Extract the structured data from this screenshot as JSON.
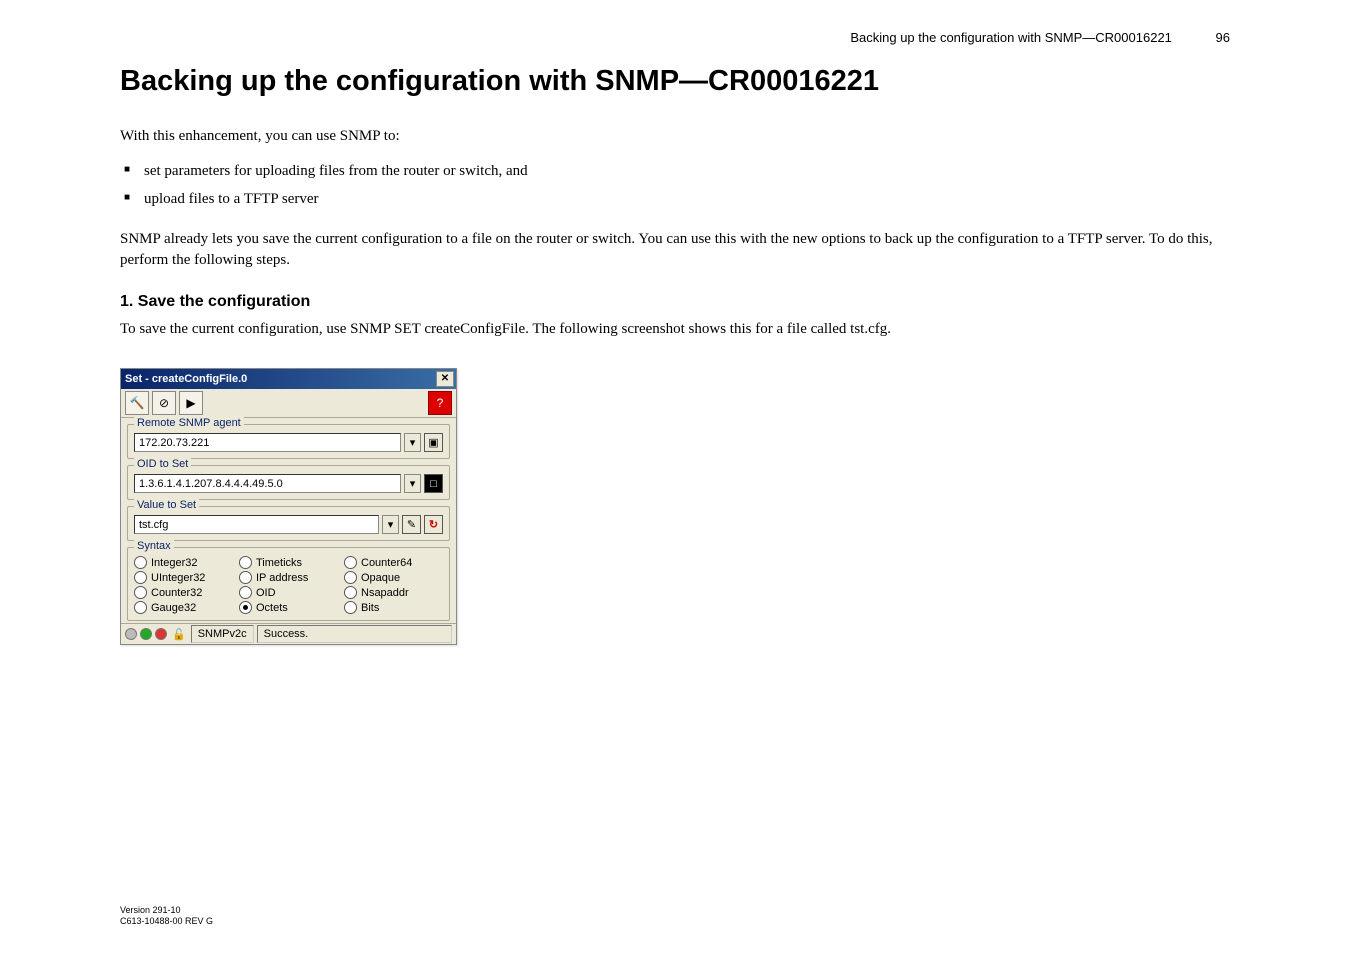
{
  "header": {
    "running_title": "Backing up the configuration with SNMP—CR00016221",
    "page_number": "96"
  },
  "title": "Backing up the configuration with SNMP—CR00016221",
  "intro": "With this enhancement, you can use SNMP to:",
  "bullets": [
    "set parameters for uploading files from the router or switch, and",
    "upload files to a TFTP server"
  ],
  "para2": "SNMP already lets you save the current configuration to a file on the router or switch. You can use this with the new options to back up the configuration to a TFTP server. To do this, perform the following steps.",
  "step1_heading": "1.  Save the configuration",
  "step1_text": "To save the current configuration, use SNMP SET createConfigFile. The following screenshot shows this for a file called tst.cfg.",
  "dialog": {
    "title": "Set - createConfigFile.0",
    "remote_agent_label": "Remote SNMP agent",
    "remote_agent_value": "172.20.73.221",
    "oid_label": "OID to Set",
    "oid_value": "1.3.6.1.4.1.207.8.4.4.4.49.5.0",
    "value_label": "Value to Set",
    "value_value": "tst.cfg",
    "syntax_label": "Syntax",
    "syntax_options": [
      {
        "label": "Integer32",
        "selected": false
      },
      {
        "label": "Timeticks",
        "selected": false
      },
      {
        "label": "Counter64",
        "selected": false
      },
      {
        "label": "UInteger32",
        "selected": false
      },
      {
        "label": "IP address",
        "selected": false
      },
      {
        "label": "Opaque",
        "selected": false
      },
      {
        "label": "Counter32",
        "selected": false
      },
      {
        "label": "OID",
        "selected": false
      },
      {
        "label": "Nsapaddr",
        "selected": false
      },
      {
        "label": "Gauge32",
        "selected": false
      },
      {
        "label": "Octets",
        "selected": true
      },
      {
        "label": "Bits",
        "selected": false
      }
    ],
    "snmp_version": "SNMPv2c",
    "status": "Success."
  },
  "footer": {
    "line1": "Version 291-10",
    "line2": "C613-10488-00 REV G"
  }
}
